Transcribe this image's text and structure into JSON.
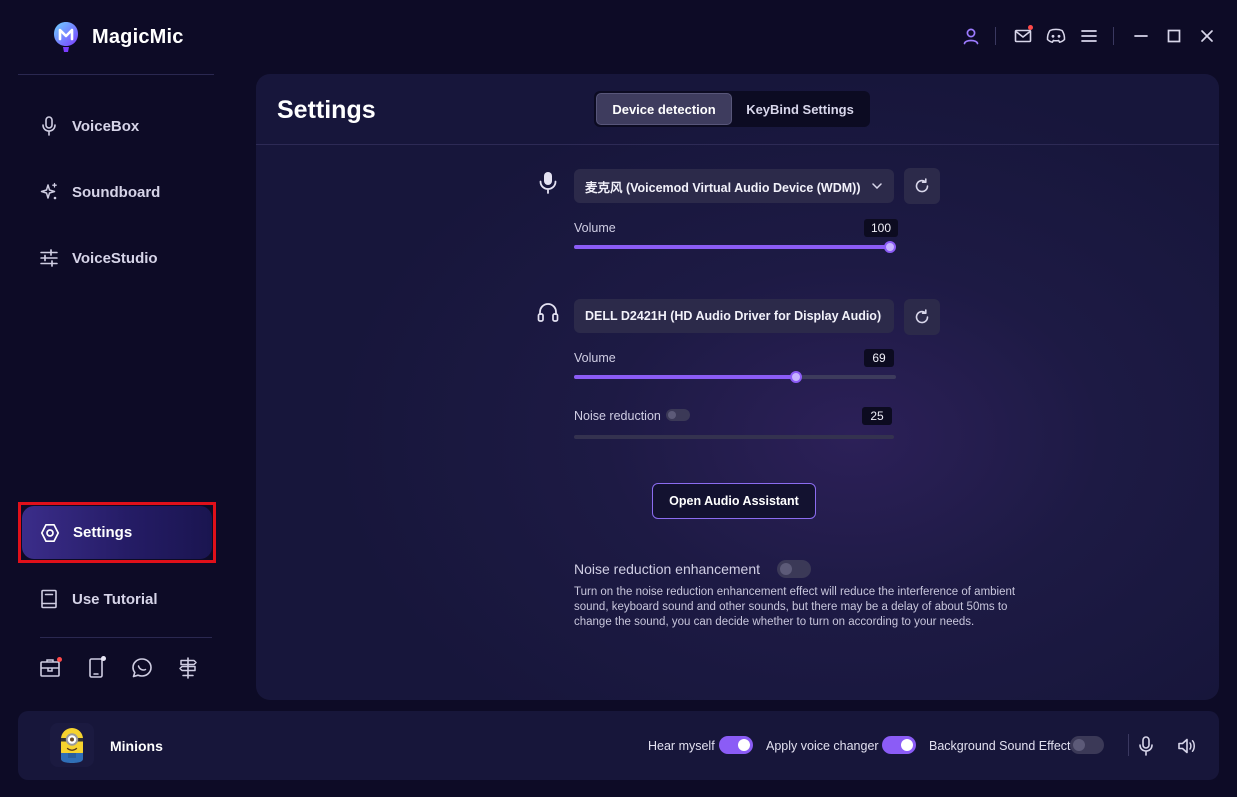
{
  "app": {
    "name": "MagicMic"
  },
  "topbar": {
    "icons": [
      "user-icon",
      "mail-icon",
      "discord-icon",
      "menu-icon",
      "minimize-icon",
      "maximize-icon",
      "close-icon"
    ]
  },
  "sidebar": {
    "items": [
      {
        "label": "VoiceBox",
        "icon": "microphone-icon"
      },
      {
        "label": "Soundboard",
        "icon": "sparkle-icon"
      },
      {
        "label": "VoiceStudio",
        "icon": "sliders-icon"
      },
      {
        "label": "Settings",
        "icon": "settings-icon",
        "active": true
      },
      {
        "label": "Use Tutorial",
        "icon": "book-icon"
      }
    ],
    "bottom_icons": [
      "toolbox-icon",
      "mobile-icon",
      "chat-icon",
      "signpost-icon"
    ]
  },
  "settings": {
    "title": "Settings",
    "tabs": [
      {
        "label": "Device detection",
        "active": true
      },
      {
        "label": "KeyBind Settings",
        "active": false
      }
    ],
    "input_device": {
      "icon": "microphone-icon",
      "selected": "麦克风 (Voicemod Virtual Audio Device (WDM))",
      "volume_label": "Volume",
      "volume": 100
    },
    "output_device": {
      "icon": "headphones-icon",
      "selected": "DELL D2421H (HD Audio Driver for Display Audio)",
      "volume_label": "Volume",
      "volume": 69
    },
    "noise_reduction": {
      "label": "Noise reduction",
      "enabled": false,
      "value": 25
    },
    "audio_assistant_button": "Open Audio Assistant",
    "noise_reduction_enhancement": {
      "label": "Noise reduction enhancement",
      "enabled": false,
      "description": "Turn on the noise reduction enhancement effect will reduce the interference of ambient sound, keyboard sound and other sounds, but there may be a delay of about 50ms to change the sound, you can decide whether to turn on according to your needs."
    }
  },
  "footer": {
    "voice_name": "Minions",
    "hear_myself": {
      "label": "Hear myself",
      "enabled": true
    },
    "apply_voice_changer": {
      "label": "Apply voice changer",
      "enabled": true
    },
    "background_sound": {
      "label": "Background Sound Effect",
      "enabled": false
    }
  },
  "colors": {
    "accent": "#8b5cf6",
    "background": "#0d0b26",
    "panel": "#1d1a44",
    "highlight_border": "#e0101a",
    "notification": "#ff4a4a"
  }
}
